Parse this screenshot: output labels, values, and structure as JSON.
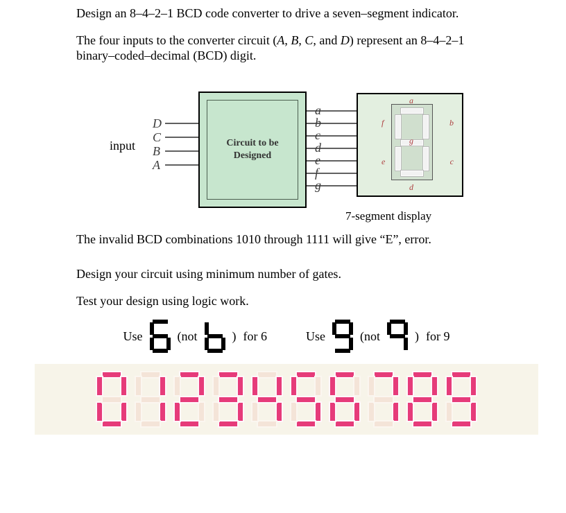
{
  "text": {
    "title": "Design an 8–4–2–1 BCD code converter to drive a seven–segment indicator.",
    "para2a": "The four inputs to the converter circuit (",
    "para2b": ") represent an 8–4–2–1 binary–coded–decimal (BCD) digit.",
    "invalid": "The invalid BCD combinations 1010 through 1111 will give “E”, error.",
    "min_gates": "Design your circuit using minimum number of gates.",
    "test": "Test your design using logic work.",
    "use_word": "Use",
    "not_open": "(not",
    "not_close": ")",
    "for6": "for 6",
    "for9": "for 9"
  },
  "inputs_label": "input",
  "input_names": [
    "A",
    "B",
    "C",
    "D"
  ],
  "inputs_display": [
    "D",
    "C",
    "B",
    "A"
  ],
  "outputs": [
    "a",
    "b",
    "c",
    "d",
    "e",
    "f",
    "g"
  ],
  "circuit_box": {
    "line1": "Circuit to be",
    "line2": "Designed"
  },
  "display_caption": "7-segment display",
  "seg_panel_labels": {
    "a": "a",
    "b": "b",
    "c": "c",
    "d": "d",
    "e": "e",
    "f": "f",
    "g": "g"
  },
  "use_glyphs": {
    "six_good": {
      "a": true,
      "b": false,
      "c": true,
      "d": true,
      "e": true,
      "f": true,
      "g": true
    },
    "six_bad": {
      "a": false,
      "b": false,
      "c": true,
      "d": true,
      "e": true,
      "f": true,
      "g": true
    },
    "nine_good": {
      "a": true,
      "b": true,
      "c": true,
      "d": true,
      "e": false,
      "f": true,
      "g": true
    },
    "nine_bad": {
      "a": true,
      "b": true,
      "c": true,
      "d": false,
      "e": false,
      "f": true,
      "g": true
    }
  },
  "seg_row": [
    {
      "a": true,
      "b": true,
      "c": true,
      "d": true,
      "e": true,
      "f": true,
      "g": false
    },
    {
      "a": false,
      "b": true,
      "c": true,
      "d": false,
      "e": false,
      "f": false,
      "g": false
    },
    {
      "a": true,
      "b": true,
      "c": false,
      "d": true,
      "e": true,
      "f": false,
      "g": true
    },
    {
      "a": true,
      "b": true,
      "c": true,
      "d": true,
      "e": false,
      "f": false,
      "g": true
    },
    {
      "a": false,
      "b": true,
      "c": true,
      "d": false,
      "e": false,
      "f": true,
      "g": true
    },
    {
      "a": true,
      "b": false,
      "c": true,
      "d": true,
      "e": false,
      "f": true,
      "g": true
    },
    {
      "a": true,
      "b": false,
      "c": true,
      "d": true,
      "e": true,
      "f": true,
      "g": true
    },
    {
      "a": true,
      "b": true,
      "c": true,
      "d": false,
      "e": false,
      "f": false,
      "g": false
    },
    {
      "a": true,
      "b": true,
      "c": true,
      "d": true,
      "e": true,
      "f": true,
      "g": true
    },
    {
      "a": true,
      "b": true,
      "c": true,
      "d": true,
      "e": false,
      "f": true,
      "g": true
    }
  ]
}
